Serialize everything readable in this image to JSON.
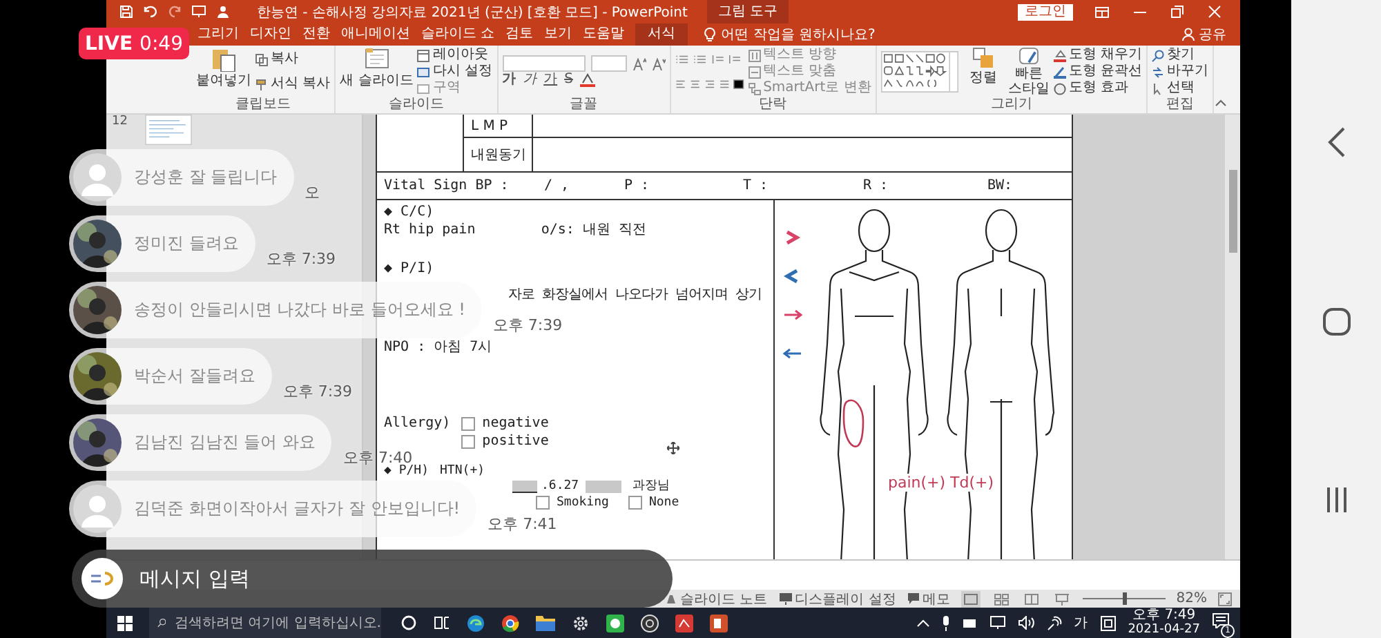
{
  "live": {
    "label": "LIVE",
    "time": "0:49"
  },
  "powerpoint": {
    "title": "한능연 - 손해사정 강의자료 2021년 (군산) [호환 모드] - PowerPoint",
    "context_label": "그림 도구",
    "login": "로그인",
    "tabs": [
      {
        "label": "그리기",
        "kind": "normal",
        "selected": false
      },
      {
        "label": "디자인",
        "kind": "normal",
        "selected": false
      },
      {
        "label": "전환",
        "kind": "normal",
        "selected": false
      },
      {
        "label": "애니메이션",
        "kind": "normal",
        "selected": false
      },
      {
        "label": "슬라이드 쇼",
        "kind": "normal",
        "selected": false
      },
      {
        "label": "검토",
        "kind": "normal",
        "selected": false
      },
      {
        "label": "보기",
        "kind": "normal",
        "selected": false
      },
      {
        "label": "도움말",
        "kind": "normal",
        "selected": false
      },
      {
        "label": "서식",
        "kind": "contextual",
        "selected": false
      }
    ],
    "tell_me": "어떤 작업을 원하시나요?",
    "share": "공유",
    "ribbon": {
      "clipboard": {
        "title": "클립보드",
        "paste": "붙여넣기",
        "copy": "복사",
        "format_painter": "서식 복사"
      },
      "slides": {
        "title": "슬라이드",
        "new_slide": "새 슬라이드",
        "layout": "레이아웃",
        "reset": "다시 설정",
        "section": "구역"
      },
      "font": {
        "title": "글꼴",
        "format_buttons": [
          "가",
          "가",
          "가",
          "S"
        ]
      },
      "paragraph": {
        "title": "단락",
        "text_direction": "텍스트 방향",
        "align_text": "텍스트 맞춤",
        "smartart": "SmartArt로 변환"
      },
      "drawing": {
        "title": "그리기",
        "arrange": "정렬",
        "quick_styles": "빠른 스타일",
        "fill": "도형 채우기",
        "outline": "도형 윤곽선",
        "effects": "도형 효과"
      },
      "editing": {
        "title": "편집",
        "find": "찾기",
        "replace": "바꾸기",
        "select": "선택"
      }
    },
    "thumbnails": [
      {
        "number": "12",
        "selected": false
      }
    ],
    "slide": {
      "lmp": "L M P",
      "visit_reason": "내원동기",
      "vitals": [
        "Vital Sign BP :",
        "/ ,",
        "P :",
        "T :",
        "R :",
        "BW:"
      ],
      "cc": {
        "heading": "◆ C/C)",
        "text": "Rt hip pain",
        "onset": "o/s: 내원 직전"
      },
      "pi": {
        "heading": "◆ P/I)",
        "text": "자로 화장실에서 나오다가 넘어지며 상기",
        "npo": "NPO : 아침 7시"
      },
      "allergy": {
        "label": "Allergy)",
        "options": [
          {
            "label": "negative",
            "checked": false
          },
          {
            "label": "positive",
            "checked": false
          }
        ]
      },
      "ph": {
        "heading": "◆ P/H)",
        "htn": "HTN(+)",
        "date": ".6.27",
        "title": "과장님",
        "options": [
          {
            "label": "Smoking",
            "checked": false
          },
          {
            "label": "None",
            "checked": false
          }
        ]
      },
      "markers": [
        {
          "kind": "chevron-right",
          "color": "#d9436a"
        },
        {
          "kind": "chevron-left",
          "color": "#2f6db5"
        },
        {
          "kind": "arrow-right",
          "color": "#d9436a"
        },
        {
          "kind": "arrow-left",
          "color": "#2f6db5"
        }
      ],
      "finding": "pain(+) Td(+)"
    },
    "status": {
      "notes": "슬라이드 노트",
      "display": "디스플레이 설정",
      "comments": "메모",
      "zoom": "82%",
      "zoom_slider": {
        "level": 0.5
      }
    }
  },
  "taskbar": {
    "search_placeholder": "검색하려면 여기에 입력하십시오.",
    "ime": "가",
    "time": "오후 7:49",
    "date": "2021-04-27",
    "notification_count": "1"
  },
  "chat": {
    "messages": [
      {
        "text": "강성훈 잘 들립니다",
        "time": "오",
        "kind": "silhouette"
      },
      {
        "text": "정미진 들려요",
        "time": "오후 7:39"
      },
      {
        "text": "송정이 안들리시면 나갔다 바로 들어오세요 !",
        "time": "오후 7:39"
      },
      {
        "text": "박순서 잘들려요",
        "time": "오후 7:39"
      },
      {
        "text": "김남진 김남진 들어 와요",
        "time": "오후 7:40"
      },
      {
        "text": "김덕준 화면이작아서 글자가 잘 안보입니다!",
        "time": "오후 7:41",
        "kind": "silhouette"
      }
    ],
    "input_placeholder": "메시지 입력"
  }
}
